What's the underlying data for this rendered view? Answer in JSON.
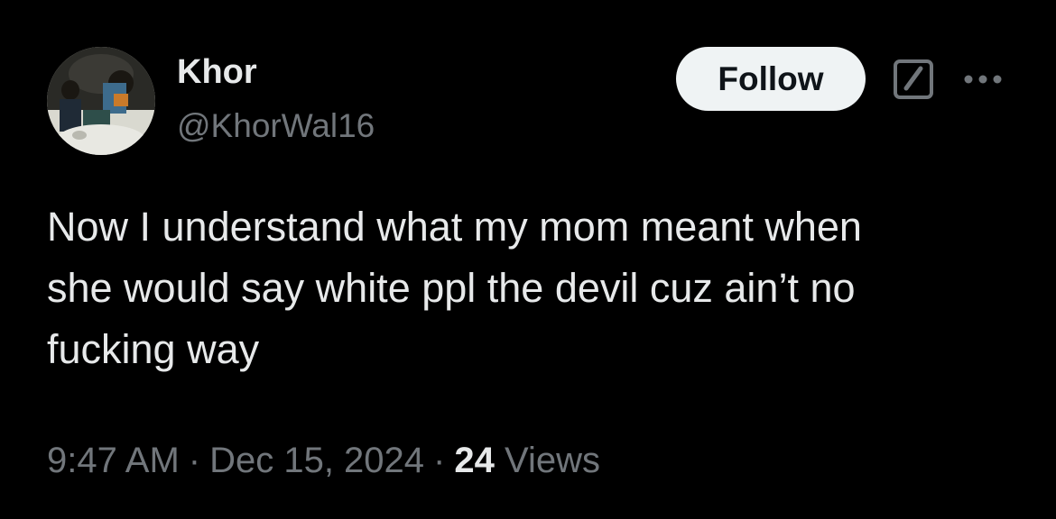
{
  "author": {
    "display_name": "Khor",
    "handle": "@KhorWal16"
  },
  "actions": {
    "follow_label": "Follow",
    "grok_icon": "grok-icon",
    "more_icon": "more-icon"
  },
  "tweet": {
    "text_lines": [
      "Now I understand what my mom meant when",
      "she would say white ppl the devil cuz ain’t no",
      "fucking way"
    ]
  },
  "meta": {
    "time": "9:47 AM",
    "separator": "·",
    "date": "Dec 15, 2024",
    "views_count": "24",
    "views_label": "Views"
  },
  "colors": {
    "background": "#000000",
    "primary_text": "#e7e9ea",
    "secondary_text": "#71767b",
    "follow_button_bg": "#eff3f4",
    "follow_button_text": "#0f1419"
  }
}
